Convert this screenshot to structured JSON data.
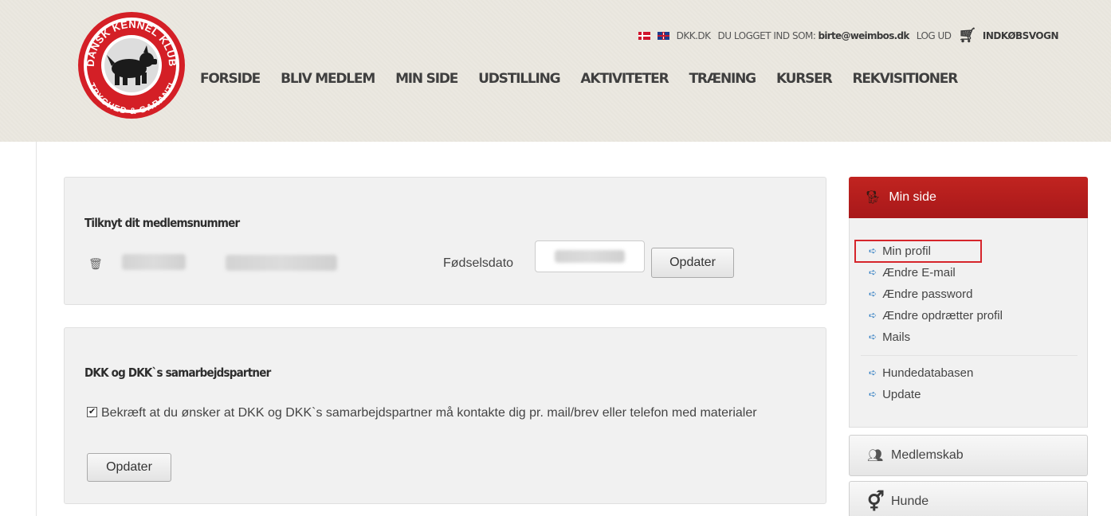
{
  "header": {
    "logo": {
      "text_top": "DANSK KENNEL KLUB",
      "text_bottom": "TRYGHED & GARANTI"
    },
    "topbar": {
      "lang_dk_icon": "danish-flag-icon",
      "lang_en_icon": "uk-flag-icon",
      "site_link": "DKK.DK",
      "logged_in_label": "DU LOGGET IND SOM:",
      "user_email": "birte@weimbos.dk",
      "logout": "LOG UD",
      "cart_icon": "shopping-cart-icon",
      "cart": "INDKØBSVOGN"
    },
    "nav": [
      {
        "label": "FORSIDE"
      },
      {
        "label": "BLIV MEDLEM"
      },
      {
        "label": "MIN SIDE"
      },
      {
        "label": "UDSTILLING"
      },
      {
        "label": "AKTIVITETER"
      },
      {
        "label": "TRÆNING"
      },
      {
        "label": "KURSER"
      },
      {
        "label": "REKVISITIONER"
      }
    ]
  },
  "member_panel": {
    "title": "Tilknyt dit medlemsnummer",
    "dob_label": "Fødselsdato",
    "button": "Opdater"
  },
  "consent_panel": {
    "title": "DKK og DKK`s samarbejdspartner",
    "checked": true,
    "text": "Bekræft at du ønsker at DKK og DKK`s samarbejdspartner må kontakte dig pr. mail/brev eller telefon med materialer",
    "button": "Opdater"
  },
  "sidebar": {
    "header": "Min side",
    "links": [
      {
        "label": "Min profil"
      },
      {
        "label": "Ændre E-mail"
      },
      {
        "label": "Ændre password"
      },
      {
        "label": "Ændre opdrætter profil"
      },
      {
        "label": "Mails"
      }
    ],
    "links2": [
      {
        "label": "Hundedatabasen"
      },
      {
        "label": "Update"
      }
    ],
    "btn_membership": "Medlemskab",
    "btn_dogs": "Hunde"
  },
  "colors": {
    "accent_red": "#b51e1d",
    "link_arrow": "#2d7cc1",
    "highlight_box": "#d6252b"
  }
}
